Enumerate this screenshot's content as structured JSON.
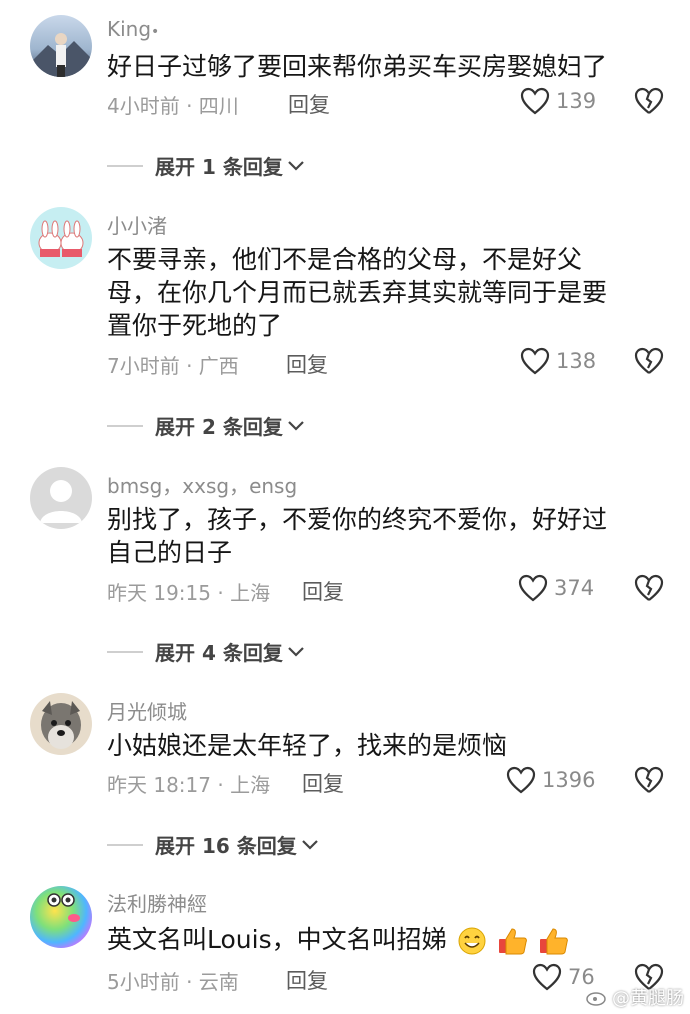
{
  "comments": [
    {
      "username": "King",
      "dot": "•",
      "text": "好日子过够了要回来帮你弟买车买房娶媳妇了",
      "time_location": "4小时前 · 四川",
      "reply_label": "回复",
      "likes": "139",
      "expand_label": "展开 1 条回复",
      "avatar_icon": "person-mountain-avatar"
    },
    {
      "username": "小小渚",
      "text_lines": [
        "不要寻亲，他们不是合格的父母，不是好父",
        "母，在你几个月而已就丢弃其实就等同于是要",
        "置你于死地的了"
      ],
      "time_location": "7小时前 · 广西",
      "reply_label": "回复",
      "likes": "138",
      "expand_label": "展开 2 条回复",
      "avatar_icon": "cartoon-bunnies-avatar"
    },
    {
      "username": "bmsg，xxsg，ensg",
      "text_lines": [
        "别找了，孩子，不爱你的终究不爱你，好好过",
        "自己的日子"
      ],
      "time_location": "昨天 19:15 · 上海",
      "reply_label": "回复",
      "likes": "374",
      "expand_label": "展开 4 条回复",
      "avatar_icon": "default-user-avatar"
    },
    {
      "username": "月光倾城",
      "text": "小姑娘还是太年轻了，找来的是烦恼",
      "time_location": "昨天 18:17 · 上海",
      "reply_label": "回复",
      "likes": "1396",
      "expand_label": "展开 16 条回复",
      "avatar_icon": "schnauzer-dog-avatar"
    },
    {
      "username": "法利勝神經",
      "text": "英文名叫Louis，中文名叫招娣",
      "time_location": "5小时前 · 云南",
      "reply_label": "回复",
      "likes": "76",
      "avatar_icon": "rainbow-frog-avatar"
    }
  ],
  "watermark": "@黄腿肠",
  "colors": {
    "text": "#161616",
    "meta": "#9b9b9b",
    "username": "#8c8c8c"
  }
}
